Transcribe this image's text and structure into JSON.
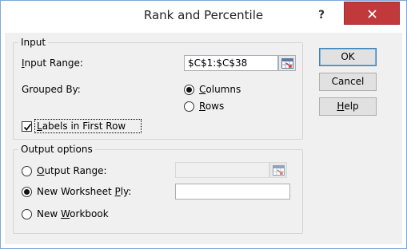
{
  "window": {
    "title": "Rank and Percentile",
    "help_glyph": "?"
  },
  "input_group": {
    "legend": "Input",
    "input_range": {
      "label_pre": "",
      "label_acc": "I",
      "label_post": "nput Range:",
      "value": "$C$1:$C$38"
    },
    "grouped_by": {
      "label": "Grouped By:",
      "columns": {
        "label_acc": "C",
        "label_post": "olumns",
        "selected": true
      },
      "rows": {
        "label_acc": "R",
        "label_post": "ows",
        "selected": false
      }
    },
    "labels_first_row": {
      "label_acc": "L",
      "label_post": "abels in First Row",
      "checked": true
    }
  },
  "output_group": {
    "legend": "Output options",
    "output_range": {
      "label_acc": "O",
      "label_post": "utput Range:",
      "value": "",
      "selected": false
    },
    "new_worksheet": {
      "label_pre": "New Worksheet ",
      "label_acc": "P",
      "label_post": "ly:",
      "value": "",
      "selected": true
    },
    "new_workbook": {
      "label_pre": "New ",
      "label_acc": "W",
      "label_post": "orkbook",
      "selected": false
    }
  },
  "buttons": {
    "ok": "OK",
    "cancel": "Cancel",
    "help": {
      "label_acc": "H",
      "label_post": "elp"
    }
  }
}
